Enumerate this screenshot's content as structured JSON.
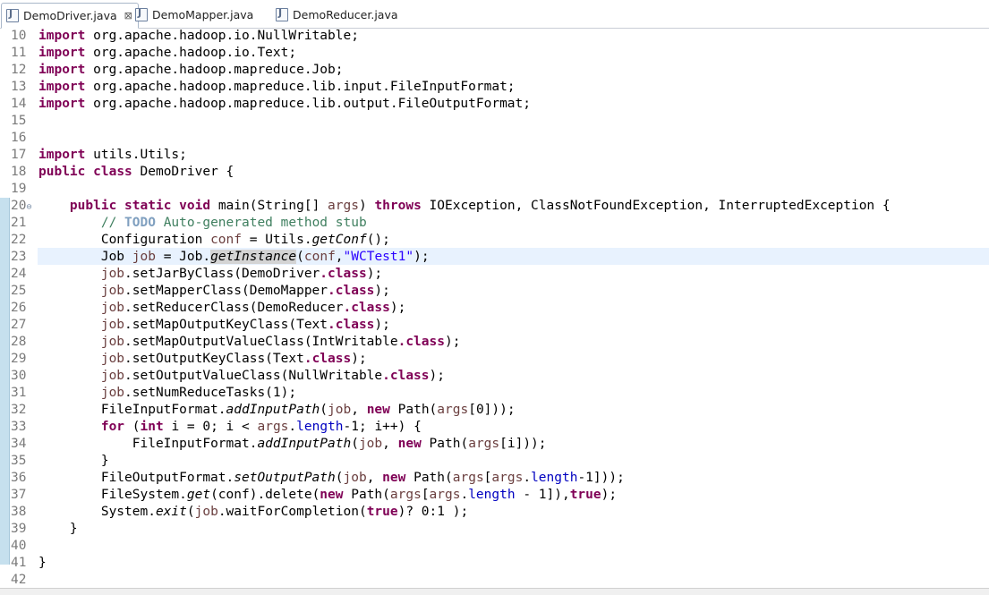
{
  "tabs": [
    {
      "label": "DemoDriver.java",
      "close": "⊠",
      "active": true
    },
    {
      "label": "DemoMapper.java"
    },
    {
      "label": "DemoReducer.java"
    }
  ],
  "editor": {
    "line_numbers": [
      "10",
      "11",
      "12",
      "13",
      "14",
      "15",
      "16",
      "17",
      "18",
      "19",
      "20",
      "21",
      "22",
      "23",
      "24",
      "25",
      "26",
      "27",
      "28",
      "29",
      "30",
      "31",
      "32",
      "33",
      "34",
      "35",
      "36",
      "37",
      "38",
      "39",
      "40",
      "41",
      "42"
    ],
    "fold_marker": "⊖",
    "tok": {
      "import": "import",
      "public": "public",
      "class": "class",
      "static": "static",
      "void": "void",
      "throws": "throws",
      "new": "new",
      "for": "for",
      "int": "int",
      "dotclass": ".class",
      "true": "true",
      "todo": "TODO",
      "pkg_nullwritable": " org.apache.hadoop.io.NullWritable;",
      "pkg_text": " org.apache.hadoop.io.Text;",
      "pkg_job": " org.apache.hadoop.mapreduce.Job;",
      "pkg_fileinput": " org.apache.hadoop.mapreduce.lib.input.FileInputFormat;",
      "pkg_fileoutput": " org.apache.hadoop.mapreduce.lib.output.FileOutputFormat;",
      "pkg_utils": " utils.Utils;",
      "class_decl": " DemoDriver {",
      "main_sig": " main(String[] ",
      "args": "args",
      "main_exc": " IOException, ClassNotFoundException, InterruptedException {",
      "cmt_prefix": "// ",
      "cmt_rest": " Auto-generated method stub",
      "conf_decl": "Configuration ",
      "conf": "conf",
      "eq": " = ",
      "utils_dot": "Utils.",
      "getConf": "getConf",
      "call_end": "();",
      "job_type": "Job ",
      "job": "job",
      "job_dot": "Job.",
      "ge": "ge",
      "tInstance": "tInstance",
      "open_paren": "(",
      "comma": ",",
      "wctest": "\"WCTest1\"",
      "close_semi": ");",
      "setJarByClass": ".setJarByClass(DemoDriver",
      "setMapperClass": ".setMapperClass(DemoMapper",
      "setReducerClass": ".setReducerClass(DemoReducer",
      "setMapOutputKeyClass": ".setMapOutputKeyClass(Text",
      "setMapOutputValueClass": ".setMapOutputValueClass(IntWritable",
      "setOutputKeyClass": ".setOutputKeyClass(Text",
      "setOutputValueClass": ".setOutputValueClass(NullWritable",
      "setNumReduceTasks": ".setNumReduceTasks(1);",
      "fif_dot": "FileInputFormat.",
      "addInputPath": "addInputPath",
      "job_comma": ", ",
      "path_open": " Path(",
      "idx0": "[0]));",
      "for_open": " (",
      "i_init": " i = 0; i < ",
      "dot": ".",
      "length": "length",
      "for_end": "-1; i++) {",
      "idx_i": "[i]));",
      "brace_close": "}",
      "fof_dot": "FileOutputFormat.",
      "setOutputPath": "setOutputPath",
      "lbrack": "[",
      "minus1_end": "-1]));",
      "fs_dot": "FileSystem.",
      "get": "get",
      "delete_part": "(conf).delete(",
      "minus1_sp": " - 1]),",
      "sys_dot": "System.",
      "exit": "exit",
      "wait_call": ".waitForCompletion(",
      "tern_end": ")? 0:1 );"
    }
  }
}
